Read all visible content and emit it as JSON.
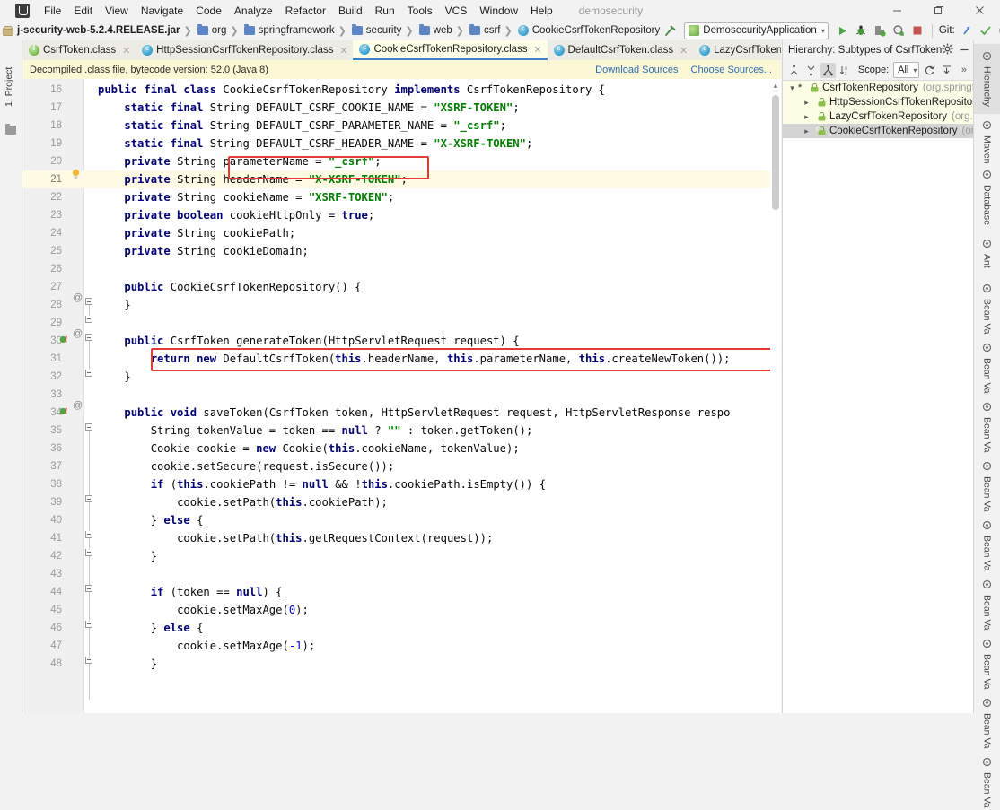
{
  "window": {
    "title": "demosecurity",
    "menu": [
      "File",
      "Edit",
      "View",
      "Navigate",
      "Code",
      "Analyze",
      "Refactor",
      "Build",
      "Run",
      "Tools",
      "VCS",
      "Window",
      "Help"
    ],
    "controls": [
      "minimize",
      "maximize",
      "close"
    ]
  },
  "breadcrumb": {
    "items": [
      {
        "label": "j-security-web-5.2.4.RELEASE.jar",
        "icon": "jar-icon",
        "bold": true
      },
      {
        "label": "org",
        "icon": "folder-icon",
        "bold": false
      },
      {
        "label": "springframework",
        "icon": "folder-icon",
        "bold": false
      },
      {
        "label": "security",
        "icon": "folder-icon",
        "bold": false
      },
      {
        "label": "web",
        "icon": "folder-icon",
        "bold": false
      },
      {
        "label": "csrf",
        "icon": "folder-icon",
        "bold": false
      },
      {
        "label": "CookieCsrfTokenRepository",
        "icon": "class-icon",
        "bold": false
      }
    ]
  },
  "toolbar": {
    "run_config": "DemosecurityApplication",
    "git_label": "Git:",
    "buttons": [
      "build-hammer",
      "run",
      "debug",
      "run-coverage",
      "profile",
      "stop",
      "git-update",
      "git-commit",
      "git-history",
      "git-rollback",
      "open-window",
      "search-everywhere"
    ]
  },
  "tabs": [
    {
      "label": "CsrfToken.class",
      "icon": "interface-icon",
      "active": false
    },
    {
      "label": "HttpSessionCsrfTokenRepository.class",
      "icon": "class-icon",
      "active": false
    },
    {
      "label": "CookieCsrfTokenRepository.class",
      "icon": "class-icon",
      "active": true
    },
    {
      "label": "DefaultCsrfToken.class",
      "icon": "class-icon",
      "active": false
    },
    {
      "label": "LazyCsrfTokenRepository.class",
      "icon": "class-icon",
      "active": false
    }
  ],
  "banner": {
    "text": "Decompiled .class file, bytecode version: 52.0 (Java 8)",
    "download_sources": "Download Sources",
    "choose_sources": "Choose Sources..."
  },
  "editor": {
    "lines": [
      {
        "num": "16",
        "html": "<span class='k'>public final class</span> <span class='t'>CookieCsrfTokenRepository</span> <span class='k'>implements</span> <span class='t'>CsrfTokenRepository</span> {"
      },
      {
        "num": "17",
        "html": "    <span class='k'>static final</span> <span class='t'>String DEFAULT_CSRF_COOKIE_NAME</span> = <span class='s'>\"XSRF-TOKEN\"</span>;"
      },
      {
        "num": "18",
        "html": "    <span class='k'>static final</span> <span class='t'>String DEFAULT_CSRF_PARAMETER_NAME</span> = <span class='s'>\"_csrf\"</span>;"
      },
      {
        "num": "19",
        "html": "    <span class='k'>static final</span> <span class='t'>String DEFAULT_CSRF_HEADER_NAME</span> = <span class='s'>\"X-XSRF-TOKEN\"</span>;"
      },
      {
        "num": "20",
        "html": "    <span class='k'>private</span> <span class='t'>String parameterName</span> = <span class='s'>\"_csrf\"</span>;"
      },
      {
        "num": "21",
        "html": "    <span class='k'>private</span> <span class='t'>String headerName</span> = <span class='s'>\"X-XSRF-TOKEN\"</span>;",
        "highlight": true
      },
      {
        "num": "22",
        "html": "    <span class='k'>private</span> <span class='t'>String cookieName</span> = <span class='s'>\"XSRF-TOKEN\"</span>;"
      },
      {
        "num": "23",
        "html": "    <span class='k'>private boolean</span> <span class='t'>cookieHttpOnly</span> = <span class='k'>true</span>;"
      },
      {
        "num": "24",
        "html": "    <span class='k'>private</span> <span class='t'>String cookiePath</span>;"
      },
      {
        "num": "25",
        "html": "    <span class='k'>private</span> <span class='t'>String cookieDomain</span>;"
      },
      {
        "num": "26",
        "html": ""
      },
      {
        "num": "27",
        "html": "    <span class='k'>public</span> <span class='t'>CookieCsrfTokenRepository</span>() {"
      },
      {
        "num": "28",
        "html": "    }"
      },
      {
        "num": "29",
        "html": ""
      },
      {
        "num": "30",
        "html": "    <span class='k'>public</span> <span class='t'>CsrfToken generateToken</span>(<span class='t'>HttpServletRequest request</span>) {"
      },
      {
        "num": "31",
        "html": "        <span class='k'>return new</span> <span class='t'>DefaultCsrfToken</span>(<span class='k'>this</span>.<span class='t'>headerName</span>, <span class='k'>this</span>.<span class='t'>parameterName</span>, <span class='k'>this</span>.<span class='t'>createNewToken</span>());"
      },
      {
        "num": "32",
        "html": "    }"
      },
      {
        "num": "33",
        "html": ""
      },
      {
        "num": "34",
        "html": "    <span class='k'>public void</span> <span class='t'>saveToken</span>(<span class='t'>CsrfToken token</span>, <span class='t'>HttpServletRequest request</span>, <span class='t'>HttpServletResponse respo</span>"
      },
      {
        "num": "35",
        "html": "        <span class='t'>String tokenValue</span> = <span class='t'>token</span> == <span class='k'>null</span> ? <span class='s'>\"\"</span> : <span class='t'>token.getToken</span>();"
      },
      {
        "num": "36",
        "html": "        <span class='t'>Cookie cookie</span> = <span class='k'>new</span> <span class='t'>Cookie</span>(<span class='k'>this</span>.<span class='t'>cookieName</span>, <span class='t'>tokenValue</span>);"
      },
      {
        "num": "37",
        "html": "        <span class='t'>cookie.setSecure</span>(<span class='t'>request.isSecure</span>());"
      },
      {
        "num": "38",
        "html": "        <span class='k'>if</span> (<span class='k'>this</span>.<span class='t'>cookiePath</span> != <span class='k'>null</span> &amp;&amp; !<span class='k'>this</span>.<span class='t'>cookiePath.isEmpty</span>()) {"
      },
      {
        "num": "39",
        "html": "            <span class='t'>cookie.setPath</span>(<span class='k'>this</span>.<span class='t'>cookiePath</span>);"
      },
      {
        "num": "40",
        "html": "        } <span class='k'>else</span> {"
      },
      {
        "num": "41",
        "html": "            <span class='t'>cookie.setPath</span>(<span class='k'>this</span>.<span class='t'>getRequestContext</span>(<span class='t'>request</span>));"
      },
      {
        "num": "42",
        "html": "        }"
      },
      {
        "num": "43",
        "html": ""
      },
      {
        "num": "44",
        "html": "        <span class='k'>if</span> (<span class='t'>token</span> == <span class='k'>null</span>) {"
      },
      {
        "num": "45",
        "html": "            <span class='t'>cookie.setMaxAge</span>(<span class='n'>0</span>);"
      },
      {
        "num": "46",
        "html": "        } <span class='k'>else</span> {"
      },
      {
        "num": "47",
        "html": "            <span class='t'>cookie.setMaxAge</span>(<span class='n'>-1</span>);"
      },
      {
        "num": "48",
        "html": "        }"
      }
    ],
    "gutter_marks": [
      {
        "line": "21",
        "type": "intention-bulb"
      },
      {
        "line": "27",
        "type": "override-at"
      },
      {
        "line": "30",
        "type": "run-and-override"
      },
      {
        "line": "34",
        "type": "run-and-override"
      }
    ],
    "annotations": [
      {
        "name": "parameter-name-highlight",
        "target": "parameterName = \"_csrf\";"
      },
      {
        "name": "return-statement-highlight",
        "target": "return new DefaultCsrfToken(this.headerName, this.parameterName, this.createNewToken());"
      }
    ]
  },
  "hierarchy": {
    "title": "Hierarchy: Subtypes of CsrfToken...",
    "gear": "settings-icon",
    "minimize": "minimize-icon",
    "scope_label": "Scope:",
    "scope_value": "All",
    "toolbar_icons": [
      "supertypes-icon",
      "subtypes-icon",
      "class-hierarchy-icon",
      "sort-alpha-icon",
      "refresh-icon",
      "export-icon",
      "more-icon"
    ],
    "tree": [
      {
        "label": "CsrfTokenRepository",
        "package": "(org.springf",
        "icon": "interface-icon",
        "expanded": true,
        "star": true,
        "indent": 0,
        "selected": false
      },
      {
        "label": "HttpSessionCsrfTokenRepository",
        "package": "",
        "icon": "class-icon",
        "expanded": false,
        "star": false,
        "indent": 1,
        "selected": false
      },
      {
        "label": "LazyCsrfTokenRepository",
        "package": "(org.sp",
        "icon": "class-icon",
        "expanded": false,
        "star": false,
        "indent": 1,
        "selected": false
      },
      {
        "label": "CookieCsrfTokenRepository",
        "package": "(org",
        "icon": "class-icon",
        "expanded": false,
        "star": false,
        "indent": 1,
        "selected": true
      }
    ]
  },
  "right_strip": {
    "tabs": [
      "Hierarchy",
      "Maven",
      "Database",
      "Ant",
      "Bean Va",
      "Bean Va",
      "Bean Va",
      "Bean Va",
      "Bean Va",
      "Bean Va",
      "Bean Va",
      "Bean Va",
      "Bean Va"
    ]
  },
  "left_strip": {
    "tabs": [
      "1: Project"
    ]
  },
  "colors": {
    "accent_blue": "#3f7fd0",
    "highlight_red": "#e53935",
    "banner_yellow": "#fcf7d4",
    "active_tab": "#fffee7",
    "keyword": "#00007f",
    "string": "#008000",
    "number": "#0000ff"
  }
}
